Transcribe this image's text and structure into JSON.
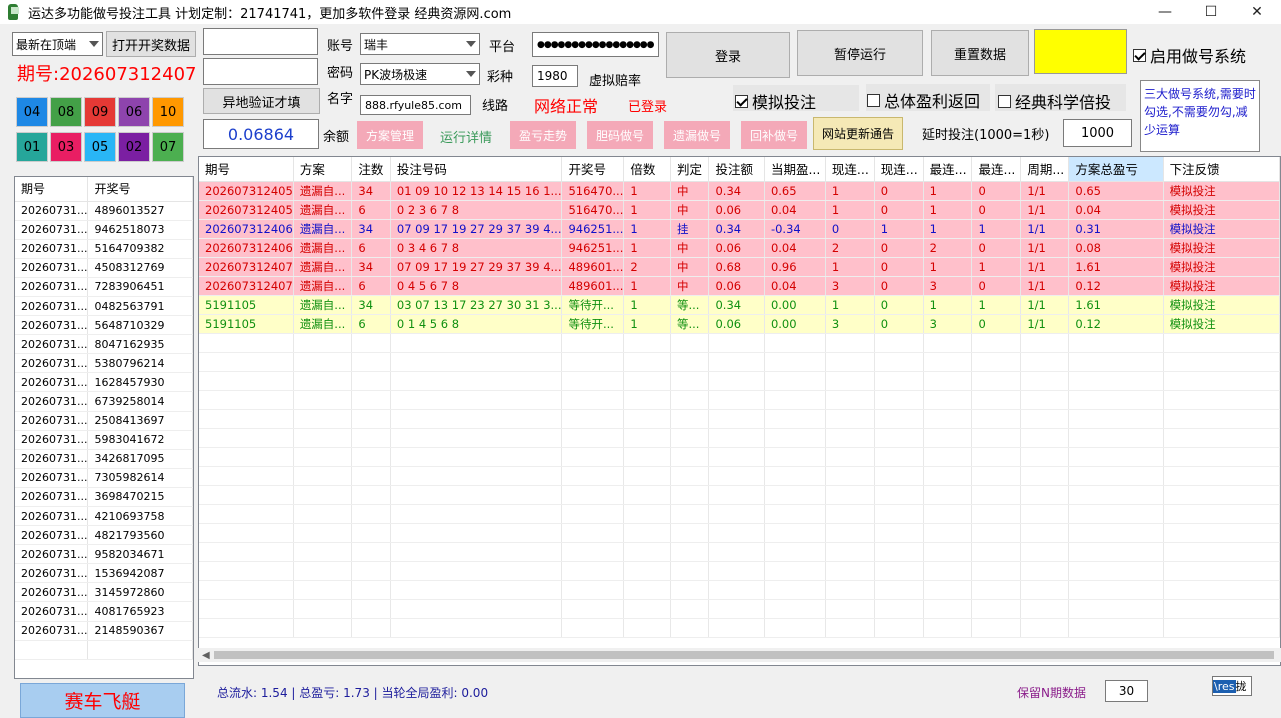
{
  "window": {
    "title": "运达多功能做号投注工具 计划定制：21741741，更加多软件登录 经典资源网.com",
    "minimize": "—",
    "maximize": "☐",
    "close": "✕"
  },
  "left": {
    "sort_select": "最新在顶端",
    "open_draw_button": "打开开奖数据",
    "period_label": "期号:202607312407",
    "balls_row1": [
      "04",
      "08",
      "09",
      "06",
      "10"
    ],
    "balls_row2": [
      "01",
      "03",
      "05",
      "02",
      "07"
    ],
    "ball_colors_row1": [
      "#1e88e5",
      "#43a047",
      "#e53935",
      "#8e44ad",
      "#ff9800"
    ],
    "ball_colors_row2": [
      "#26a69a",
      "#e91e63",
      "#29b6f6",
      "#7b1fa2",
      "#4caf50"
    ],
    "history_headers": [
      "期号",
      "开奖号"
    ],
    "history": [
      [
        "20260731...",
        "4896013527"
      ],
      [
        "20260731...",
        "9462518073"
      ],
      [
        "20260731...",
        "5164709382"
      ],
      [
        "20260731...",
        "4508312769"
      ],
      [
        "20260731...",
        "7283906451"
      ],
      [
        "20260731...",
        "0482563791"
      ],
      [
        "20260731...",
        "5648710329"
      ],
      [
        "20260731...",
        "8047162935"
      ],
      [
        "20260731...",
        "5380796214"
      ],
      [
        "20260731...",
        "1628457930"
      ],
      [
        "20260731...",
        "6739258014"
      ],
      [
        "20260731...",
        "2508413697"
      ],
      [
        "20260731...",
        "5983041672"
      ],
      [
        "20260731...",
        "3426817095"
      ],
      [
        "20260731...",
        "7305982614"
      ],
      [
        "20260731...",
        "3698470215"
      ],
      [
        "20260731...",
        "4210693758"
      ],
      [
        "20260731...",
        "4821793560"
      ],
      [
        "20260731...",
        "9582034671"
      ],
      [
        "20260731...",
        "1536942087"
      ],
      [
        "20260731...",
        "3145972860"
      ],
      [
        "20260731...",
        "4081765923"
      ],
      [
        "20260731...",
        "2148590367"
      ]
    ],
    "game_button": "赛车飞艇"
  },
  "login": {
    "field1_value": "",
    "field2_value": "",
    "verify_button": "异地验证才填",
    "balance_value": "0.06864",
    "account_label": "账号",
    "password_label": "密码",
    "name_label": "名字",
    "balance_label": "余额",
    "account_select": "瑞丰",
    "password_select": "PK波场极速",
    "name_value": "888.rfyule85.com",
    "platform_label": "平台",
    "platform_value": "●●●●●●●●●●●●●●●●●",
    "lottery_label": "彩种",
    "lottery_value": "1980",
    "odds_label": "虚拟赔率",
    "line_label": "线路",
    "network_status": "网络正常",
    "login_status": "已登录"
  },
  "toolbar": {
    "login_button": "登录",
    "pause_button": "暂停运行",
    "reset_button": "重置数据",
    "enable_system": "启用做号系统",
    "simulate_bet": "模拟投注",
    "total_profit_return": "总体盈利返回",
    "classic_double": "经典科学倍投",
    "tip_text": "三大做号系统,需要时勾选,不需要勿勾,减少运算",
    "plan_manage": "方案管理",
    "run_detail": "运行详情",
    "profit_trend": "盈亏走势",
    "guts_number": "胆码做号",
    "miss_number": "遗漏做号",
    "back_number": "回补做号",
    "site_notice": "网站更新通告",
    "delay_label": "延时投注(1000=1秒)",
    "delay_value": "1000"
  },
  "grid": {
    "headers": [
      "期号",
      "方案",
      "注数",
      "投注号码",
      "开奖号",
      "倍数",
      "判定",
      "投注额",
      "当期盈...",
      "现连...",
      "现连...",
      "最连...",
      "最连...",
      "周期...",
      "方案总盈亏",
      "下注反馈"
    ],
    "rows": [
      {
        "style": "red",
        "cells": [
          "202607312405",
          "遗漏自...",
          "34",
          "01 09 10 12 13 14 15 16 1...",
          "516470...",
          "1",
          "中",
          "0.34",
          "0.65",
          "1",
          "0",
          "1",
          "0",
          "1/1",
          "0.65",
          "模拟投注"
        ]
      },
      {
        "style": "red",
        "cells": [
          "202607312405",
          "遗漏自...",
          "6",
          "0 2 3 6 7 8",
          "516470...",
          "1",
          "中",
          "0.06",
          "0.04",
          "1",
          "0",
          "1",
          "0",
          "1/1",
          "0.04",
          "模拟投注"
        ]
      },
      {
        "style": "blue",
        "cells": [
          "202607312406",
          "遗漏自...",
          "34",
          "07 09 17 19 27 29 37 39 4...",
          "946251...",
          "1",
          "挂",
          "0.34",
          "-0.34",
          "0",
          "1",
          "1",
          "1",
          "1/1",
          "0.31",
          "模拟投注"
        ]
      },
      {
        "style": "red",
        "cells": [
          "202607312406",
          "遗漏自...",
          "6",
          "0 3 4 6 7 8",
          "946251...",
          "1",
          "中",
          "0.06",
          "0.04",
          "2",
          "0",
          "2",
          "0",
          "1/1",
          "0.08",
          "模拟投注"
        ]
      },
      {
        "style": "red",
        "cells": [
          "202607312407",
          "遗漏自...",
          "34",
          "07 09 17 19 27 29 37 39 4...",
          "489601...",
          "2",
          "中",
          "0.68",
          "0.96",
          "1",
          "0",
          "1",
          "1",
          "1/1",
          "1.61",
          "模拟投注"
        ]
      },
      {
        "style": "red",
        "cells": [
          "202607312407",
          "遗漏自...",
          "6",
          "0 4 5 6 7 8",
          "489601...",
          "1",
          "中",
          "0.06",
          "0.04",
          "3",
          "0",
          "3",
          "0",
          "1/1",
          "0.12",
          "模拟投注"
        ]
      },
      {
        "style": "green",
        "cells": [
          "5191105",
          "遗漏自...",
          "34",
          "03 07 13 17 23 27 30 31 3...",
          "等待开...",
          "1",
          "等...",
          "0.34",
          "0.00",
          "1",
          "0",
          "1",
          "1",
          "1/1",
          "1.61",
          "模拟投注"
        ]
      },
      {
        "style": "green",
        "cells": [
          "5191105",
          "遗漏自...",
          "6",
          "0 1 4 5 6 8",
          "等待开...",
          "1",
          "等...",
          "0.06",
          "0.00",
          "3",
          "0",
          "3",
          "0",
          "1/1",
          "0.12",
          "模拟投注"
        ]
      }
    ]
  },
  "footer": {
    "summary": "总流水: 1.54 | 总盈亏: 1.73 | 当轮全局盈利: 0.00",
    "keep_label": "保留N期数据",
    "keep_value": "30",
    "ime_text": "\\res",
    "ime_char": "拢"
  },
  "colors": {
    "yellow_box": "#ffff00",
    "accent_red": "#ff0000",
    "pink_button": "#f4a9b8"
  }
}
